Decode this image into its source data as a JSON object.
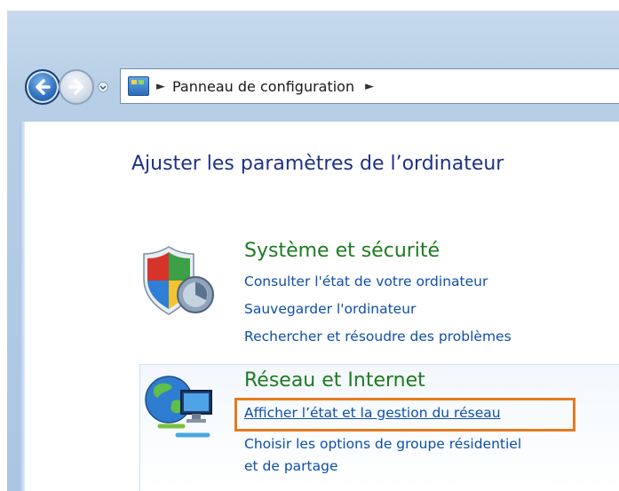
{
  "address_bar": {
    "crumbs": [
      "Panneau de configuration"
    ]
  },
  "page": {
    "title": "Ajuster les paramètres de l’ordinateur"
  },
  "categories": [
    {
      "title": "Système et sécurité",
      "icon": "shield-icon",
      "links": [
        "Consulter l'état de votre ordinateur",
        "Sauvegarder l'ordinateur",
        "Rechercher et résoudre des problèmes"
      ]
    },
    {
      "title": "Réseau et Internet",
      "icon": "network-globe-icon",
      "links": [
        "Afficher l’état et la gestion du réseau",
        "Choisir les options de groupe résidentiel",
        "et de partage"
      ]
    }
  ],
  "colors": {
    "highlight": "#e57a1f",
    "category_title": "#1e7b22",
    "link": "#0d4faa",
    "page_title": "#1e3287"
  }
}
